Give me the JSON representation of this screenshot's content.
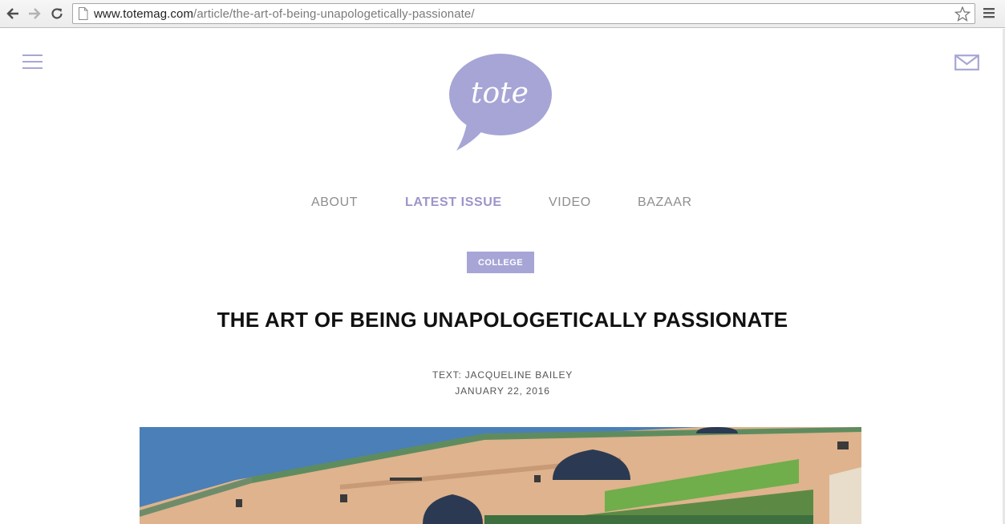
{
  "browser": {
    "url_host": "www.totemag.com",
    "url_path": "/article/the-art-of-being-unapologetically-passionate/"
  },
  "site": {
    "logo_text": "tote",
    "brand_color": "#a7a5d6"
  },
  "nav": {
    "items": [
      {
        "label": "ABOUT",
        "active": false
      },
      {
        "label": "LATEST ISSUE",
        "active": true
      },
      {
        "label": "VIDEO",
        "active": false
      },
      {
        "label": "BAZAAR",
        "active": false
      }
    ]
  },
  "article": {
    "category": "COLLEGE",
    "title": "THE ART OF BEING UNAPOLOGETICALLY PASSIONATE",
    "byline": "TEXT: JACQUELINE BAILEY",
    "date": "JANUARY 22, 2016"
  },
  "icons": {
    "back": "back-arrow-icon",
    "forward": "forward-arrow-icon",
    "reload": "reload-icon",
    "page": "page-icon",
    "bookmark": "star-icon",
    "chrome_menu": "menu-icon",
    "site_menu": "hamburger-icon",
    "contact": "mail-icon"
  }
}
